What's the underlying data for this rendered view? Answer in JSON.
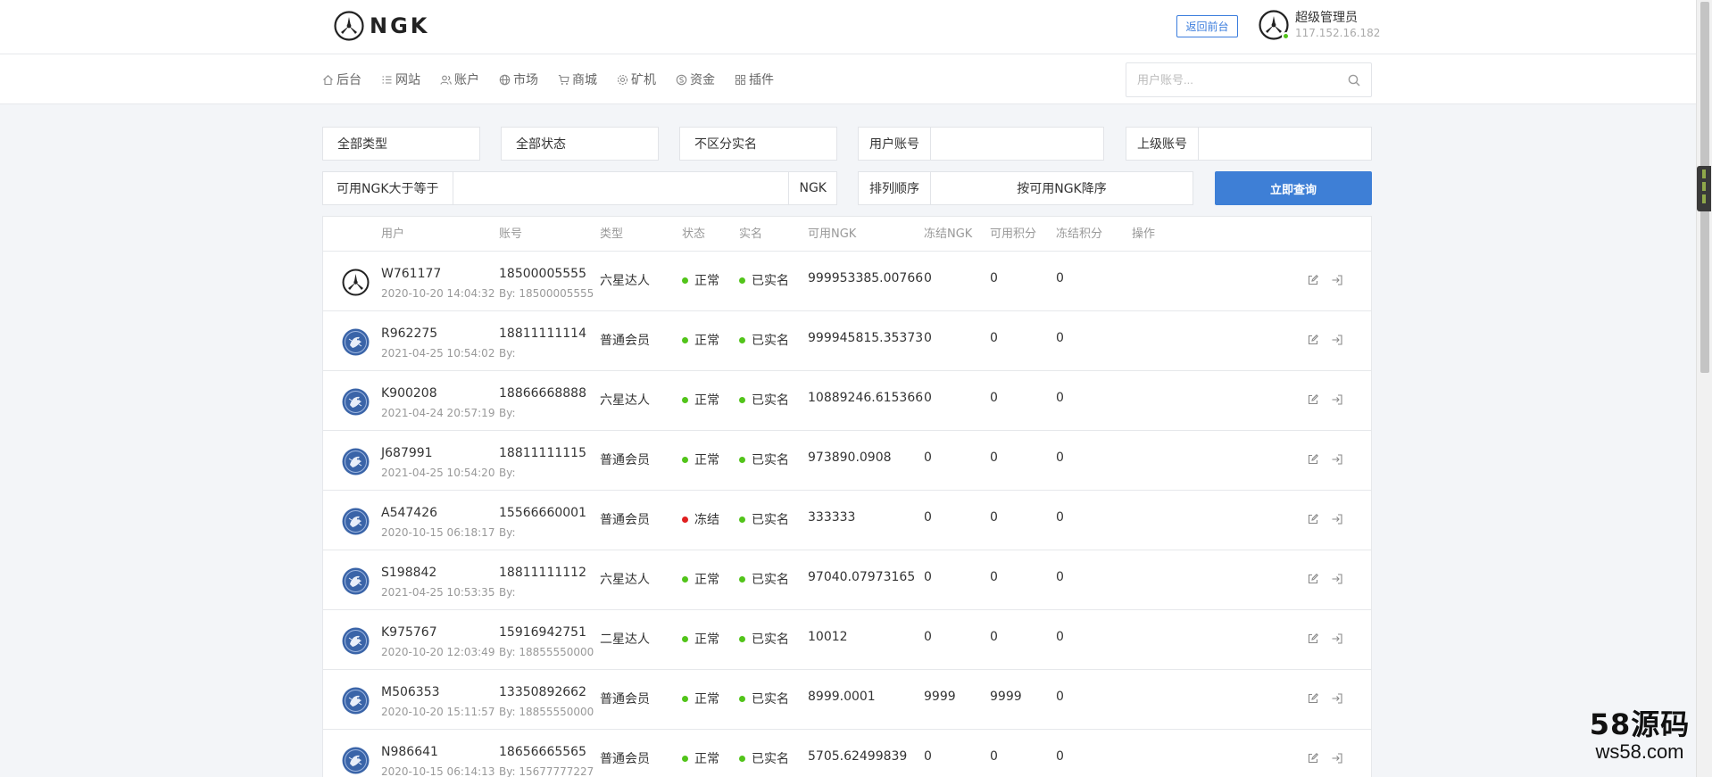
{
  "header": {
    "logo_text": "NGK",
    "back_button": "返回前台",
    "admin_name": "超级管理员",
    "admin_ip": "117.152.16.182"
  },
  "nav": {
    "items": [
      {
        "icon": "home-icon",
        "label": "后台"
      },
      {
        "icon": "list-icon",
        "label": "网站"
      },
      {
        "icon": "users-icon",
        "label": "账户"
      },
      {
        "icon": "globe-icon",
        "label": "市场"
      },
      {
        "icon": "cart-icon",
        "label": "商城"
      },
      {
        "icon": "mining-icon",
        "label": "矿机"
      },
      {
        "icon": "coin-icon",
        "label": "资金"
      },
      {
        "icon": "grid-icon",
        "label": "插件"
      }
    ],
    "search_placeholder": "用户账号..."
  },
  "filters": {
    "type_select": "全部类型",
    "status_select": "全部状态",
    "realname_select": "不区分实名",
    "user_account_label": "用户账号",
    "user_account_value": "",
    "parent_account_label": "上级账号",
    "parent_account_value": "",
    "ngk_min_label": "可用NGK大于等于",
    "ngk_min_value": "",
    "ngk_unit": "NGK",
    "sort_label": "排列顺序",
    "sort_value": "按可用NGK降序",
    "query_button": "立即查询"
  },
  "table": {
    "columns": [
      "用户",
      "账号",
      "类型",
      "状态",
      "实名",
      "可用NGK",
      "冻结NGK",
      "可用积分",
      "冻结积分",
      "操作"
    ],
    "rows": [
      {
        "avatar": "ngk-logo",
        "user": "W761177",
        "time": "2020-10-20 14:04:32",
        "account": "18500005555",
        "by": "By: 18500005555",
        "type": "六星达人",
        "status": "正常",
        "status_color": "#52c41a",
        "realname": "已实名",
        "ngk": "999953385.00766",
        "frozen_ngk": "0",
        "points": "0",
        "frozen_points": "0"
      },
      {
        "avatar": "blue-avatar",
        "user": "R962275",
        "time": "2021-04-25 10:54:02",
        "account": "18811111114",
        "by": "By:",
        "type": "普通会员",
        "status": "正常",
        "status_color": "#52c41a",
        "realname": "已实名",
        "ngk": "999945815.35373",
        "frozen_ngk": "0",
        "points": "0",
        "frozen_points": "0"
      },
      {
        "avatar": "blue-avatar",
        "user": "K900208",
        "time": "2021-04-24 20:57:19",
        "account": "18866668888",
        "by": "By:",
        "type": "六星达人",
        "status": "正常",
        "status_color": "#52c41a",
        "realname": "已实名",
        "ngk": "10889246.615366",
        "frozen_ngk": "0",
        "points": "0",
        "frozen_points": "0"
      },
      {
        "avatar": "blue-avatar",
        "user": "J687991",
        "time": "2021-04-25 10:54:20",
        "account": "18811111115",
        "by": "By:",
        "type": "普通会员",
        "status": "正常",
        "status_color": "#52c41a",
        "realname": "已实名",
        "ngk": "973890.0908",
        "frozen_ngk": "0",
        "points": "0",
        "frozen_points": "0"
      },
      {
        "avatar": "blue-avatar",
        "user": "A547426",
        "time": "2020-10-15 06:18:17",
        "account": "15566660001",
        "by": "By:",
        "type": "普通会员",
        "status": "冻结",
        "status_color": "#e02020",
        "realname": "已实名",
        "ngk": "333333",
        "frozen_ngk": "0",
        "points": "0",
        "frozen_points": "0"
      },
      {
        "avatar": "blue-avatar",
        "user": "S198842",
        "time": "2021-04-25 10:53:35",
        "account": "18811111112",
        "by": "By:",
        "type": "六星达人",
        "status": "正常",
        "status_color": "#52c41a",
        "realname": "已实名",
        "ngk": "97040.07973165",
        "frozen_ngk": "0",
        "points": "0",
        "frozen_points": "0"
      },
      {
        "avatar": "blue-avatar",
        "user": "K975767",
        "time": "2020-10-20 12:03:49",
        "account": "15916942751",
        "by": "By: 18855550000",
        "type": "二星达人",
        "status": "正常",
        "status_color": "#52c41a",
        "realname": "已实名",
        "ngk": "10012",
        "frozen_ngk": "0",
        "points": "0",
        "frozen_points": "0"
      },
      {
        "avatar": "blue-avatar",
        "user": "M506353",
        "time": "2020-10-20 15:11:57",
        "account": "13350892662",
        "by": "By: 18855550000",
        "type": "普通会员",
        "status": "正常",
        "status_color": "#52c41a",
        "realname": "已实名",
        "ngk": "8999.0001",
        "frozen_ngk": "9999",
        "points": "9999",
        "frozen_points": "0"
      },
      {
        "avatar": "blue-avatar",
        "user": "N986641",
        "time": "2020-10-15 06:14:13",
        "account": "18656665565",
        "by": "By: 15677777227",
        "type": "普通会员",
        "status": "正常",
        "status_color": "#52c41a",
        "realname": "已实名",
        "ngk": "5705.62499839",
        "frozen_ngk": "0",
        "points": "0",
        "frozen_points": "0"
      }
    ]
  },
  "watermark": {
    "line1": "58源码",
    "line2": "ws58.com"
  },
  "colors": {
    "primary": "#3e7fd6",
    "success": "#52c41a",
    "danger": "#e02020"
  }
}
